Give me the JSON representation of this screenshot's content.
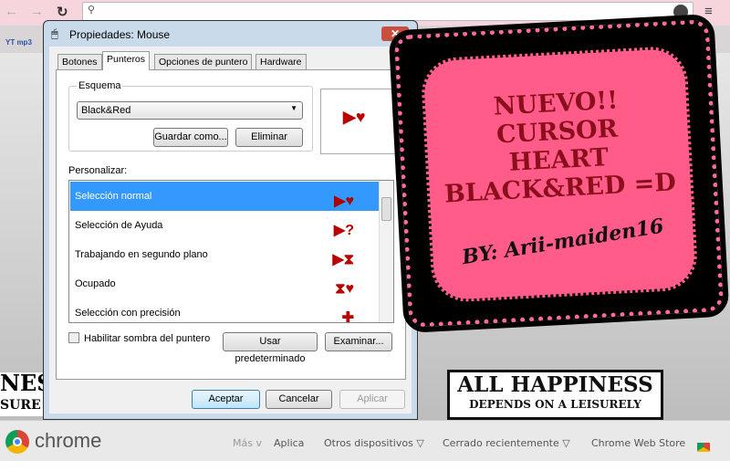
{
  "browser": {
    "bookmark_more": "»",
    "bookmark_yt": "YT mp3"
  },
  "dialog": {
    "title": "Propiedades: Mouse",
    "close": "✕",
    "tabs": [
      "Botones",
      "Punteros",
      "Opciones de puntero",
      "Hardware"
    ],
    "scheme_label": "Esquema",
    "scheme_value": "Black&Red",
    "save_as": "Guardar como...",
    "delete": "Eliminar",
    "customize_label": "Personalizar:",
    "cursor_list": [
      {
        "label": "Selección normal",
        "icon": "▶♥"
      },
      {
        "label": "Selección de Ayuda",
        "icon": "▶?"
      },
      {
        "label": "Trabajando en segundo plano",
        "icon": "▶⧗"
      },
      {
        "label": "Ocupado",
        "icon": "⧗♥"
      },
      {
        "label": "Selección con precisión",
        "icon": "✚"
      }
    ],
    "shadow_checkbox": "Habilitar sombra del puntero",
    "use_default": "Usar predeterminado",
    "browse": "Examinar...",
    "ok": "Aceptar",
    "cancel": "Cancelar",
    "apply": "Aplicar"
  },
  "sign": {
    "lines": [
      "NUEVO!!",
      "CURSOR",
      "HEART",
      "BLACK&RED =D"
    ],
    "by": "BY: Arii-maiden16"
  },
  "poster": {
    "line1": "ALL HAPPINESS",
    "line2": "DEPENDS ON A LEISURELY",
    "left_text": "NESS",
    "left_text2": "SURE"
  },
  "bottom_bar": {
    "brand": "chrome",
    "mas": "Más v",
    "aplica": "Aplica",
    "other_devices": "Otros dispositivos ▽",
    "recently_closed": "Cerrado recientemente ▽",
    "web_store": "Chrome Web Store"
  },
  "colors": {
    "selection": "#3399ff",
    "sign_pink": "#ff5c8a",
    "sign_text": "#8b0f1b"
  }
}
